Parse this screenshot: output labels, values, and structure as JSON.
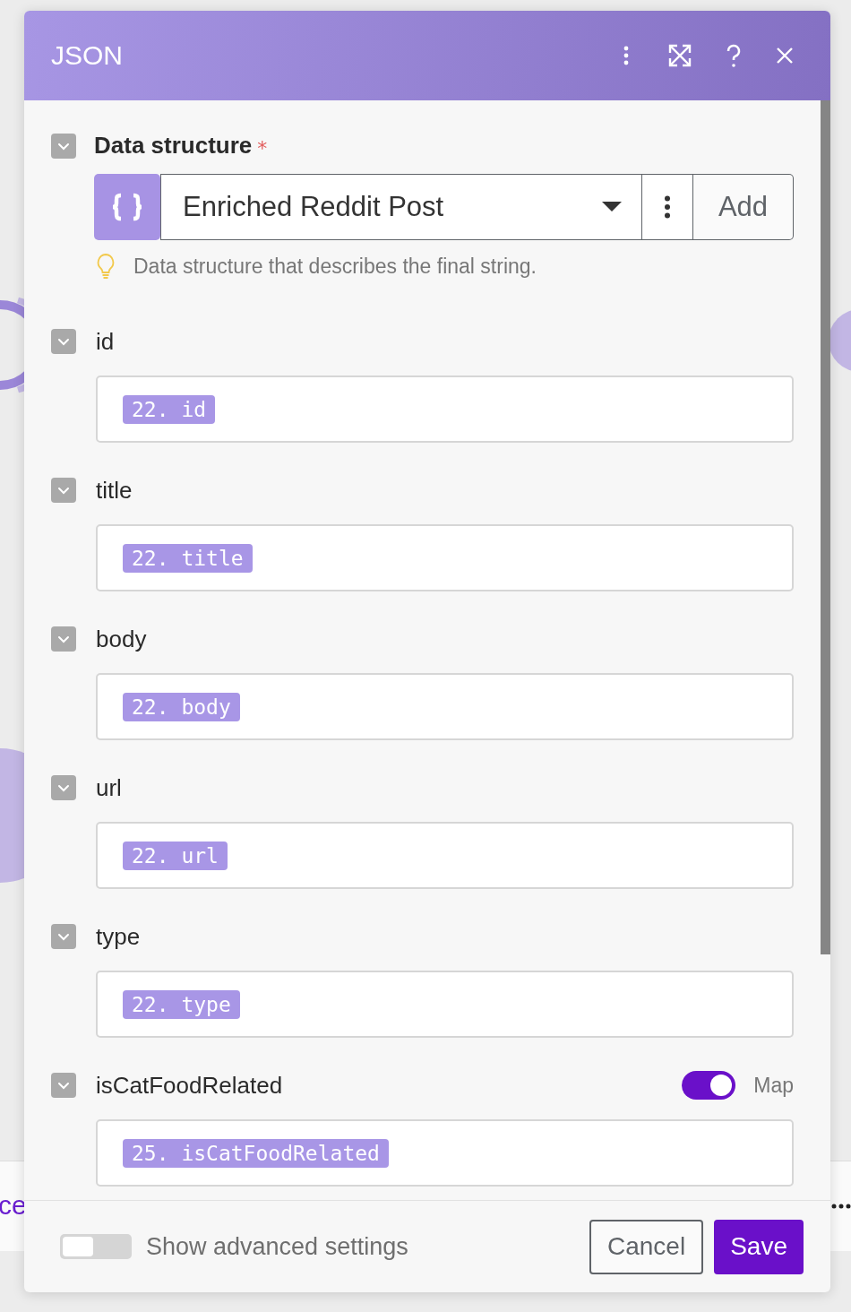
{
  "background": {
    "label_fragment": "ce"
  },
  "window": {
    "title": "JSON"
  },
  "data_structure": {
    "label": "Data structure",
    "required_mark": "*",
    "value": "Enriched Reddit Post",
    "add_button": "Add",
    "hint": "Data structure that describes the final string."
  },
  "fields": [
    {
      "label": "id",
      "token": "22. id"
    },
    {
      "label": "title",
      "token": "22. title"
    },
    {
      "label": "body",
      "token": "22. body"
    },
    {
      "label": "url",
      "token": "22. url"
    },
    {
      "label": "type",
      "token": "22. type"
    },
    {
      "label": "isCatFoodRelated",
      "token": "25. isCatFoodRelated",
      "map_toggle": {
        "on": true,
        "label": "Map"
      }
    }
  ],
  "footer": {
    "advanced_toggle": {
      "on": false,
      "label": "Show advanced settings"
    },
    "buttons": [
      {
        "label": "Cancel",
        "kind": "secondary"
      },
      {
        "label": "Save",
        "kind": "primary"
      }
    ]
  }
}
